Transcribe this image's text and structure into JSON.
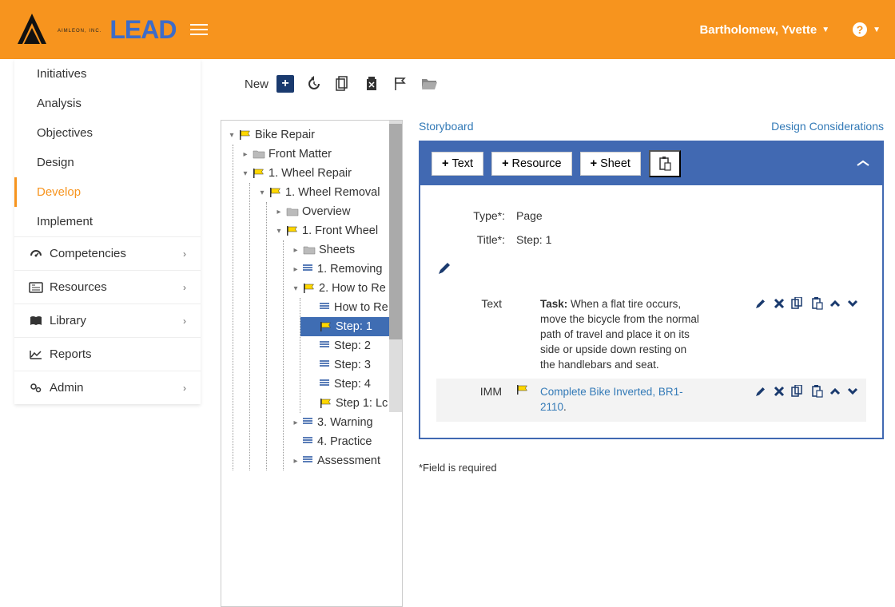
{
  "header": {
    "brand_sub": "AIMLEON, INC.",
    "brand_main": "LEAD",
    "user_name": "Bartholomew, Yvette"
  },
  "sidebar": {
    "nav": [
      "Initiatives",
      "Analysis",
      "Objectives",
      "Design",
      "Develop",
      "Implement"
    ],
    "active_index": 4,
    "sections": [
      "Competencies",
      "Resources",
      "Library",
      "Reports",
      "Admin"
    ]
  },
  "toolbar": {
    "new_label": "New"
  },
  "tree": {
    "root": "Bike Repair",
    "front": "Front Matter",
    "n1": "1. Wheel Repair",
    "n11": "1. Wheel Removal",
    "ov": "Overview",
    "fw": "1. Front Wheel",
    "sheets": "Sheets",
    "rem": "1. Removing",
    "howto": "2. How to Re",
    "howto_child": "How to Re",
    "step1": "Step: 1",
    "step2": "Step: 2",
    "step3": "Step: 3",
    "step4": "Step: 4",
    "step1lc": "Step 1: Lc",
    "warn": "3. Warning",
    "prac": "4. Practice",
    "assess": "Assessment"
  },
  "tabs": {
    "left": "Storyboard",
    "right": "Design Considerations"
  },
  "panel": {
    "btn_text": "Text",
    "btn_resource": "Resource",
    "btn_sheet": "Sheet",
    "type_label": "Type*:",
    "type_value": "Page",
    "title_label": "Title*:",
    "title_value": "Step: 1",
    "text_label": "Text",
    "text_task_prefix": "Task:",
    "text_body": " When a flat tire occurs, move the bicycle from the normal path of travel and place it on its side or upside down resting on the handlebars and seat.",
    "imm_label": "IMM",
    "imm_link": "Complete Bike Inverted, BR1-2110",
    "imm_suffix": "."
  },
  "footnote": "*Field is required"
}
